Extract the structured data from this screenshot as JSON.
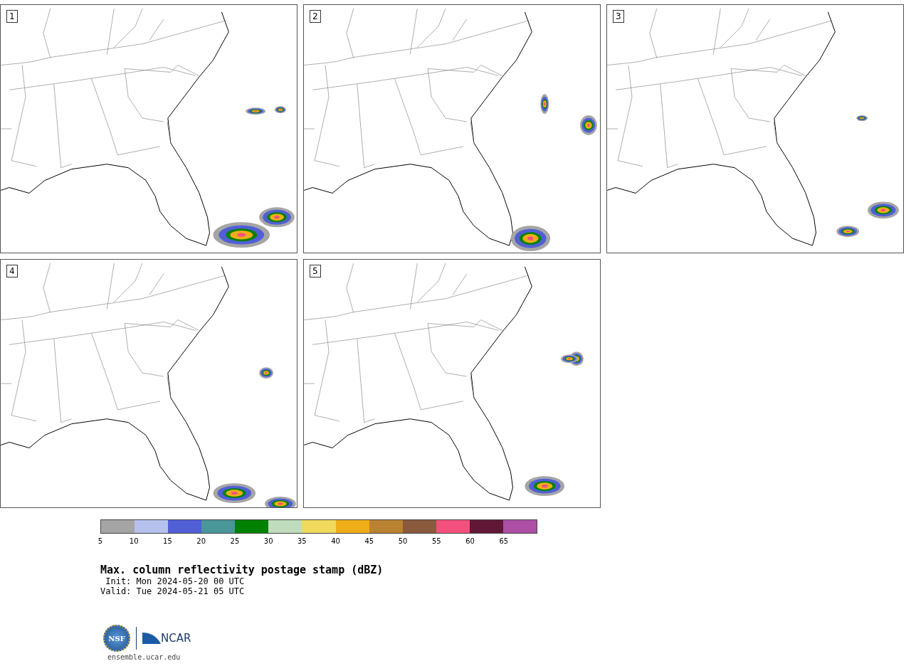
{
  "panels": [
    {
      "label": "1"
    },
    {
      "label": "2"
    },
    {
      "label": "3"
    },
    {
      "label": "4"
    },
    {
      "label": "5"
    }
  ],
  "colorbar": {
    "segments": [
      {
        "color": "#a5a5a5"
      },
      {
        "color": "#b6c2ed"
      },
      {
        "color": "#515fd6"
      },
      {
        "color": "#4b9699"
      },
      {
        "color": "#008200"
      },
      {
        "color": "#bfdcbd"
      },
      {
        "color": "#f0da5d"
      },
      {
        "color": "#efad19"
      },
      {
        "color": "#ba8331"
      },
      {
        "color": "#8a5a3e"
      },
      {
        "color": "#f3507d"
      },
      {
        "color": "#611836"
      },
      {
        "color": "#ad4fa5"
      }
    ],
    "ticks": [
      "5",
      "10",
      "15",
      "20",
      "25",
      "30",
      "35",
      "40",
      "45",
      "50",
      "55",
      "60",
      "65"
    ]
  },
  "title": "Max. column reflectivity postage stamp (dBZ)",
  "init": " Init: Mon 2024-05-20 00 UTC",
  "valid": "Valid: Tue 2024-05-21 05 UTC",
  "logo_text": "NCAR",
  "nsf_text": "NSF",
  "site": "ensemble.ucar.edu"
}
